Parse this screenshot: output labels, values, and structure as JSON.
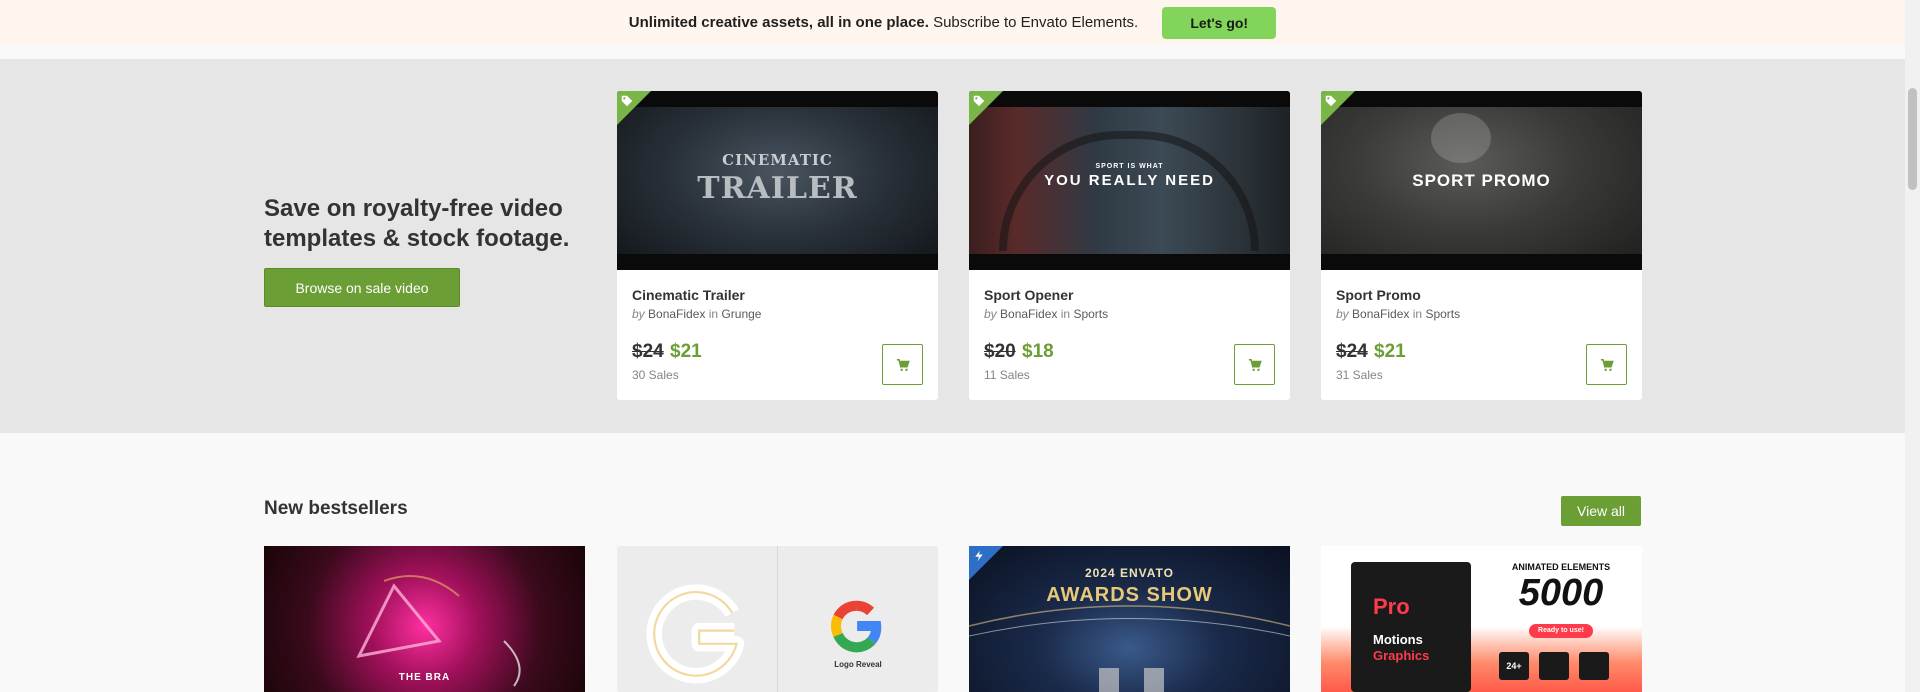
{
  "promo": {
    "bold_text": "Unlimited creative assets, all in one place.",
    "text": " Subscribe to Envato Elements.",
    "button": "Let's go!"
  },
  "sale": {
    "heading": "Save on royalty-free video templates & stock footage.",
    "button": "Browse on sale video",
    "cards": [
      {
        "title": "Cinematic Trailer",
        "by": "by",
        "author": "BonaFidex",
        "in": "in",
        "category": "Grunge",
        "old_price": "$24",
        "new_price": "$21",
        "sales": "30 Sales",
        "thumb_text_1": "CINEMATIC",
        "thumb_text_2": "TRAILER"
      },
      {
        "title": "Sport Opener",
        "by": "by",
        "author": "BonaFidex",
        "in": "in",
        "category": "Sports",
        "old_price": "$20",
        "new_price": "$18",
        "sales": "11 Sales",
        "thumb_text_1": "SPORT IS WHAT",
        "thumb_text_2": "YOU REALLY NEED"
      },
      {
        "title": "Sport Promo",
        "by": "by",
        "author": "BonaFidex",
        "in": "in",
        "category": "Sports",
        "old_price": "$24",
        "new_price": "$21",
        "sales": "31 Sales",
        "thumb_text_1": "SPORT PROMO"
      }
    ]
  },
  "bestsellers": {
    "heading": "New bestsellers",
    "view_all": "View all",
    "thumbs": [
      {
        "text": "THE BRA"
      },
      {
        "text": "Logo Reveal"
      },
      {
        "text_1": "2024 ENVATO",
        "text_2": "AWARDS SHOW"
      },
      {
        "text_1": "ANIMATED ELEMENTS",
        "text_2": "5000",
        "text_3": "Ready to use!",
        "text_4": "Pro",
        "text_5": "Motions",
        "text_6": "Graphics",
        "text_7": "24+"
      }
    ]
  },
  "colors": {
    "accent": "#6b9e34",
    "promo_button": "#82d45a",
    "promo_bg": "#fdf5ee",
    "sale_bg": "#e6e6e6"
  }
}
